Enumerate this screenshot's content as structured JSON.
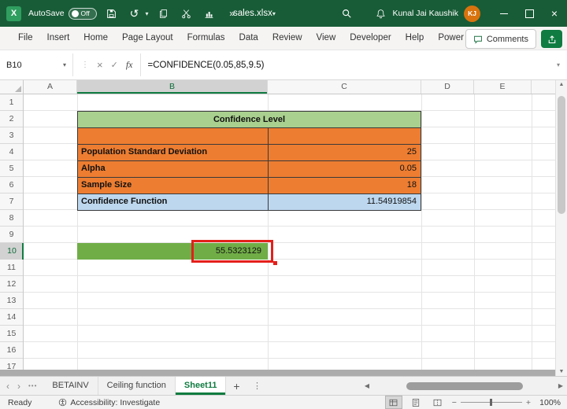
{
  "colors": {
    "title_green": "#185C37",
    "accent_green": "#107C41",
    "table_header_green": "#A9D08E",
    "orange_fill": "#ED7D31",
    "blue_fill": "#BDD7EE",
    "result_green": "#70AD47",
    "annotation_red": "#E3201B"
  },
  "title_bar": {
    "autosave_label": "AutoSave",
    "autosave_state": "Off",
    "file_name": "sales.xlsx",
    "user_name": "Kunal Jai Kaushik",
    "user_initials": "KJ"
  },
  "ribbon": {
    "tabs": [
      "File",
      "Insert",
      "Home",
      "Page Layout",
      "Formulas",
      "Data",
      "Review",
      "View",
      "Developer",
      "Help",
      "Power Pivot"
    ],
    "comments_label": "Comments"
  },
  "formula_bar": {
    "name_box": "B10",
    "fx_label": "fx",
    "formula": "=CONFIDENCE(0.05,85,9.5)"
  },
  "grid": {
    "column_headers": [
      "A",
      "B",
      "C",
      "D",
      "E"
    ],
    "row_headers": [
      "1",
      "2",
      "3",
      "4",
      "5",
      "6",
      "7",
      "8",
      "9",
      "10",
      "11",
      "12",
      "13",
      "14",
      "15",
      "16",
      "17"
    ],
    "active_cell": "B10"
  },
  "table": {
    "title": "Confidence Level",
    "rows": [
      {
        "label": "",
        "value": ""
      },
      {
        "label": "Population Standard Deviation",
        "value": "25"
      },
      {
        "label": "Alpha",
        "value": "0.05"
      },
      {
        "label": "Sample Size",
        "value": "18"
      },
      {
        "label": "Confidence Function",
        "value": "11.54919854"
      }
    ]
  },
  "result_cell": {
    "value": "55.5323129"
  },
  "sheet_tabs": {
    "overflow": "•••",
    "tabs": [
      "BETAINV",
      "Ceiling function",
      "Sheet11"
    ],
    "active": "Sheet11",
    "add_label": "+"
  },
  "status_bar": {
    "mode": "Ready",
    "accessibility_label": "Accessibility: Investigate",
    "zoom_level": "100%"
  },
  "glyphs": {
    "logo": "X",
    "caret_down": "▾",
    "undo": "↺",
    "more": "»",
    "dots": "⋮",
    "cancel": "×",
    "check": "✓",
    "chev_left": "‹",
    "chev_right": "›",
    "scroll_left": "◀",
    "scroll_right": "▶",
    "scroll_up": "▲",
    "scroll_down": "▼",
    "close": "×"
  }
}
